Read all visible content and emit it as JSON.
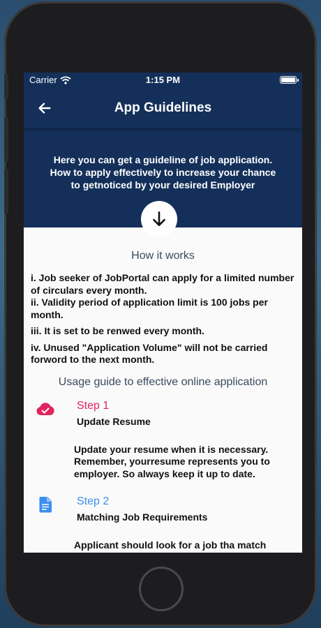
{
  "status_bar": {
    "carrier": "Carrier",
    "time": "1:15 PM"
  },
  "app_bar": {
    "title": "App Guidelines",
    "back_icon": "arrow-left-icon"
  },
  "hero": {
    "text": "Here you can get a guideline of job application. How to apply effectively to increase your chance to getnoticed by your desired Employer",
    "button_icon": "arrow-down-icon"
  },
  "how_it_works": {
    "title": "How it works",
    "rules": [
      "i. Job seeker of JobPortal can apply for a limited number of circulars every month.",
      "ii. Validity period of application limit is 100 jobs per month.",
      "iii. It is set to be renwed every month.",
      "iv. Unused \"Application Volume\" will not be carried forword to the next month."
    ]
  },
  "usage_guide": {
    "title": "Usage guide to effective online application",
    "steps": [
      {
        "label": "Step 1",
        "name": "Update Resume",
        "description": "Update your resume when it is necessary. Remember, yourresume represents you to employer. So always keep it up to date.",
        "icon": "cloud-check-icon",
        "color": "#e0245e"
      },
      {
        "label": "Step 2",
        "name": "Matching Job Requirements",
        "description": "Applicant should look for a job tha match",
        "icon": "document-icon",
        "color": "#3b8ef0"
      }
    ]
  },
  "colors": {
    "primary": "#14305a",
    "step1": "#e0245e",
    "step2": "#3b8ef0"
  }
}
